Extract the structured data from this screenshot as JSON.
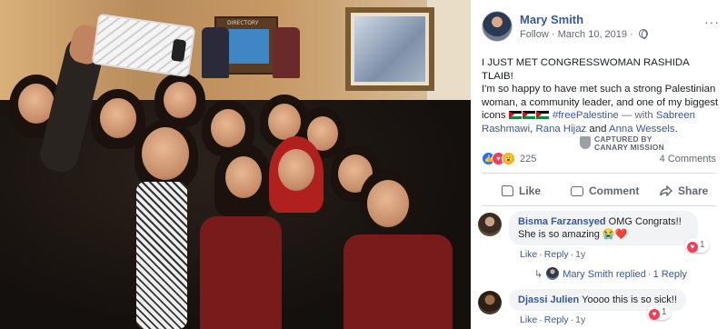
{
  "post": {
    "author": "Mary Smith",
    "follow_label": "Follow",
    "date": "March 10, 2019",
    "more_label": "···",
    "text_line1": "I JUST MET CONGRESSWOMAN RASHIDA TLAIB!",
    "text_line2": "I'm so happy to have met such a strong Palestinian woman, a community leader, and one of my biggest icons",
    "hashtag": "#freePalestine",
    "with_label": "— with",
    "tag1": "Sabreen Rashmawi",
    "tag2": "Rana Hijaz",
    "and_label": "and",
    "tag3": "Anna Wessels",
    "period": ".",
    "photo_sign": "DIRECTORY",
    "photo_alt": "Group selfie photo"
  },
  "watermark": {
    "line1": "CAPTURED BY",
    "line2": "CANARY MISSION"
  },
  "reactions": {
    "count": "225",
    "comments_count": "4 Comments"
  },
  "actions": {
    "like": "Like",
    "comment": "Comment",
    "share": "Share"
  },
  "comments": [
    {
      "name": "Bisma Farzansyed",
      "text": "OMG Congrats!! She is so amazing 😭❤️",
      "reaction_count": "1",
      "like": "Like",
      "reply": "Reply",
      "time": "1y"
    },
    {
      "name": "Djassi Julien",
      "text": "Yoooo this is so sick!!",
      "reaction_count": "1",
      "like": "Like",
      "reply": "Reply",
      "time": "1y"
    }
  ],
  "reply_summary": {
    "arrow": "↳",
    "text": "Mary Smith replied",
    "count": "1 Reply"
  },
  "colors": {
    "link_blue": "#385898",
    "meta_gray": "#616770",
    "like_blue": "#1877f2",
    "love_red": "#f33e58",
    "wow_yellow": "#f7b125"
  }
}
